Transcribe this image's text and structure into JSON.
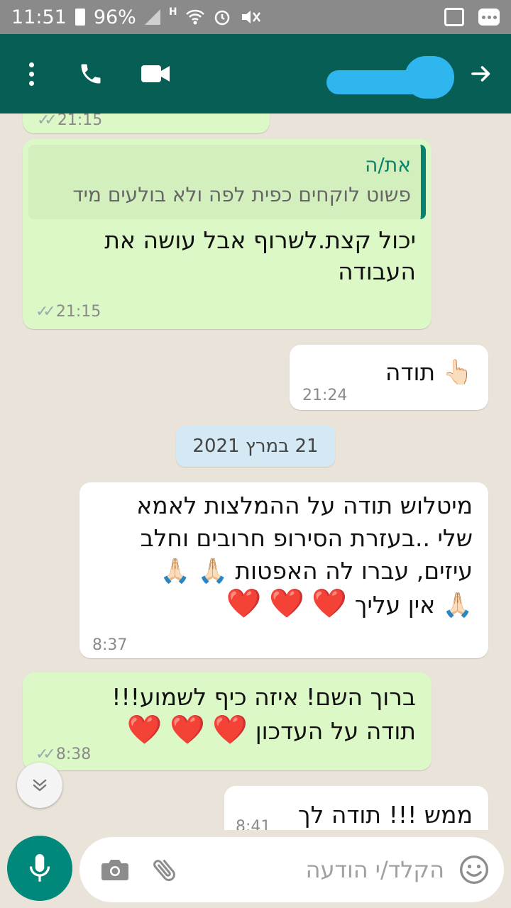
{
  "status_bar": {
    "time": "11:51",
    "battery": "96%",
    "network": "H"
  },
  "app_bar": {
    "icons": [
      "more-vert-icon",
      "call-icon",
      "videocam-icon",
      "arrow-forward-icon"
    ]
  },
  "messages": [
    {
      "dir": "out",
      "time": "21:15",
      "partial": true
    },
    {
      "dir": "out",
      "quote_author": "את/ה",
      "quote_text": "פשוט לוקחים כפית לפה ולא בולעים מיד",
      "text": "יכול קצת.לשרוף אבל עושה את העבודה",
      "time": "21:15"
    },
    {
      "dir": "in",
      "text": "תודה",
      "emoji": "👆🏻",
      "time": "21:24"
    },
    {
      "dir": "in",
      "text_line1": "מיטלוש תודה על ההמלצות לאמא",
      "text_line2": "שלי ..בעזרת הסירופ חרובים וחלב",
      "text_line3": "עיזים, עברו לה האפטות",
      "text_line4": "אין עליך",
      "emoji_pray": "🙏🏻",
      "emoji_heart": "❤️",
      "time": "8:37"
    },
    {
      "dir": "out",
      "text_line1": "ברוך השם! איזה כיף לשמוע!!!",
      "text_line2": "תודה על העדכון",
      "emoji_heart": "❤️",
      "time": "8:38"
    },
    {
      "dir": "in",
      "text": "ממש !!! תודה לך",
      "time": "8:41"
    }
  ],
  "date_chip": "21 במרץ 2021",
  "composer": {
    "placeholder": "הקלד/י הודעה"
  },
  "colors": {
    "header": "#075e54",
    "outgoing_bubble": "#dcf8c6",
    "incoming_bubble": "#ffffff",
    "mic_button": "#00897b",
    "chat_bg": "#e9e3da"
  }
}
